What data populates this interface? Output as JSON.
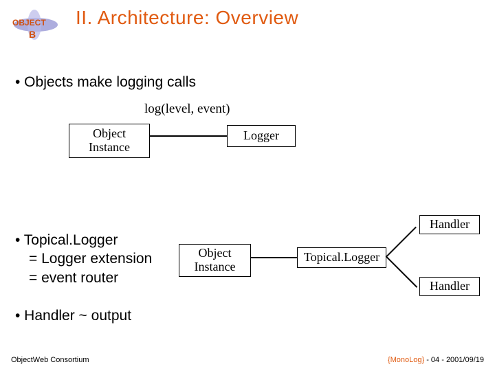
{
  "logo": {
    "top_text": "OBJECT",
    "bottom_text": "B"
  },
  "title": "II. Architecture: Overview",
  "bullets": {
    "b1": "• Objects make logging calls",
    "b2_line1": "• Topical.Logger",
    "b2_line2": "= Logger extension",
    "b2_line3": "= event router",
    "b3": "• Handler ~ output"
  },
  "diagram": {
    "call_label": "log(level, event)",
    "object_instance": "Object\nInstance",
    "logger": "Logger",
    "topical_logger": "Topical.Logger",
    "handler": "Handler"
  },
  "footer": {
    "left": "ObjectWeb Consortium",
    "right_brand": "{MonoLog}",
    "right_rest": " - 04 - 2001/09/19"
  }
}
